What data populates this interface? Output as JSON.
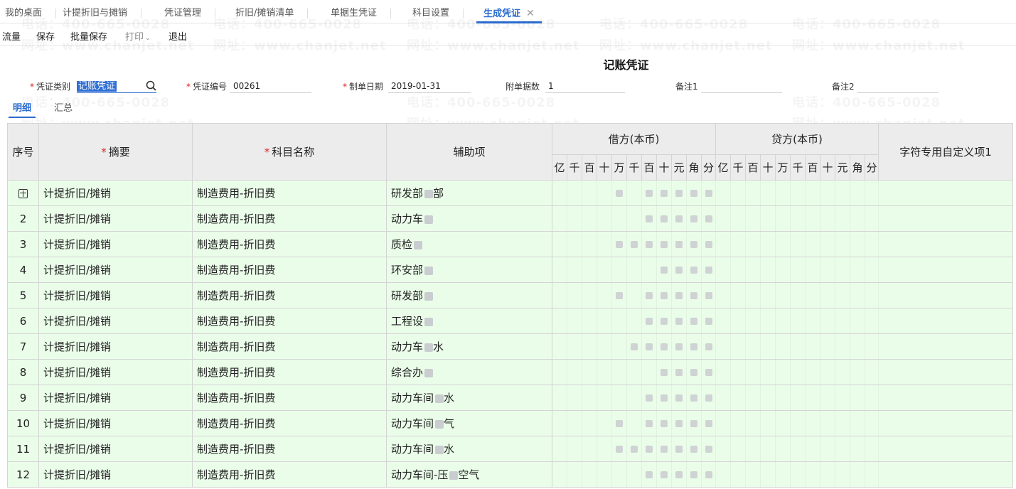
{
  "tabs": [
    {
      "label": "我的桌面"
    },
    {
      "label": "计提折旧与摊销"
    },
    {
      "label": "凭证管理"
    },
    {
      "label": "折旧/摊销清单"
    },
    {
      "label": "单据生凭证"
    },
    {
      "label": "科目设置"
    },
    {
      "label": "生成凭证",
      "close": "✕"
    }
  ],
  "toolbar": {
    "flow": "流量",
    "save": "保存",
    "batch_save": "批量保存",
    "print": "打印",
    "exit": "退出"
  },
  "title": "记账凭证",
  "header": {
    "voucher_type_label": "凭证类别",
    "voucher_type_value": "记账凭证",
    "voucher_no_label": "凭证编号",
    "voucher_no_value": "00261",
    "date_label": "制单日期",
    "date_value": "2019-01-31",
    "attach_label": "附单据数",
    "attach_value": "1",
    "note1_label": "备注1",
    "note1_value": "",
    "note2_label": "备注2",
    "note2_value": "",
    "required_mark": "*"
  },
  "subtabs": {
    "detail": "明细",
    "summary": "汇总"
  },
  "columns": {
    "seq": "序号",
    "summary": "摘要",
    "account": "科目名称",
    "aux": "辅助项",
    "debit": "借方(本币)",
    "credit": "贷方(本币)",
    "custom": "字符专用自定义项1",
    "digits": [
      "亿",
      "千",
      "百",
      "十",
      "万",
      "千",
      "百",
      "十",
      "元",
      "角",
      "分"
    ]
  },
  "rows": [
    {
      "seq": "",
      "summary": "计提折旧/摊销",
      "account": "制造费用-折旧费",
      "aux": "研发部",
      "aux_tail": "部"
    },
    {
      "seq": "2",
      "summary": "计提折旧/摊销",
      "account": "制造费用-折旧费",
      "aux": "动力车",
      "aux_tail": ""
    },
    {
      "seq": "3",
      "summary": "计提折旧/摊销",
      "account": "制造费用-折旧费",
      "aux": "质检",
      "aux_tail": ""
    },
    {
      "seq": "4",
      "summary": "计提折旧/摊销",
      "account": "制造费用-折旧费",
      "aux": "环安部",
      "aux_tail": ""
    },
    {
      "seq": "5",
      "summary": "计提折旧/摊销",
      "account": "制造费用-折旧费",
      "aux": "研发部",
      "aux_tail": ""
    },
    {
      "seq": "6",
      "summary": "计提折旧/摊销",
      "account": "制造费用-折旧费",
      "aux": "工程设",
      "aux_tail": ""
    },
    {
      "seq": "7",
      "summary": "计提折旧/摊销",
      "account": "制造费用-折旧费",
      "aux": "动力车",
      "aux_tail": "水"
    },
    {
      "seq": "8",
      "summary": "计提折旧/摊销",
      "account": "制造费用-折旧费",
      "aux": "综合办",
      "aux_tail": ""
    },
    {
      "seq": "9",
      "summary": "计提折旧/摊销",
      "account": "制造费用-折旧费",
      "aux": "动力车间",
      "aux_tail": "水"
    },
    {
      "seq": "10",
      "summary": "计提折旧/摊销",
      "account": "制造费用-折旧费",
      "aux": "动力车间",
      "aux_tail": "气"
    },
    {
      "seq": "11",
      "summary": "计提折旧/摊销",
      "account": "制造费用-折旧费",
      "aux": "动力车间",
      "aux_tail": "水"
    },
    {
      "seq": "12",
      "summary": "计提折旧/摊销",
      "account": "制造费用-折旧费",
      "aux": "动力车间-压",
      "aux_tail": "空气"
    }
  ],
  "watermark": {
    "phone": "电话：400-665-0028",
    "site": "网址：www.chanjet.net"
  },
  "colors": {
    "accent": "#2a6ccf",
    "row_bg": "#eafde9",
    "header_bg": "#ececec"
  }
}
